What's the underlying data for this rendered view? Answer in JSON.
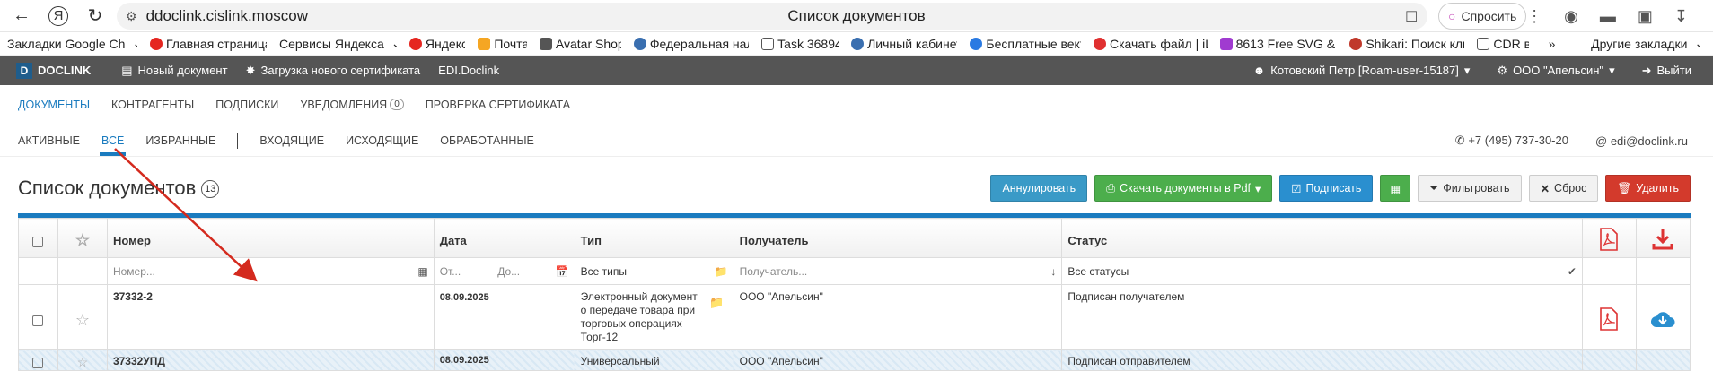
{
  "browser": {
    "url": "ddoclink.cislink.moscow",
    "tab_title": "Список документов",
    "ask_label": "Спросить"
  },
  "bookmarks": [
    {
      "label": "Закладки Google Ch",
      "color": "#ffffff"
    },
    {
      "label": "Главная страница",
      "color": "#e52620"
    },
    {
      "label": "Сервисы Яндекса",
      "color": "#ffffff"
    },
    {
      "label": "Яндекс",
      "color": "#e52620"
    },
    {
      "label": "Почта",
      "color": "#f5a623"
    },
    {
      "label": "Avatar Shop",
      "color": "#555555"
    },
    {
      "label": "Федеральная нал",
      "color": "#3a6fb0"
    },
    {
      "label": "Task 36894",
      "color": "#ffffff"
    },
    {
      "label": "Личный кабинет",
      "color": "#3a6fb0"
    },
    {
      "label": "Бесплатные вект",
      "color": "#2a7ae2"
    },
    {
      "label": "Скачать файл | iL",
      "color": "#e03030"
    },
    {
      "label": "8613 Free SVG & I",
      "color": "#a03bd0"
    },
    {
      "label": "Shikari: Поиск кли",
      "color": "#c0392b"
    },
    {
      "label": "CDR в",
      "color": "#555555"
    }
  ],
  "bookmarks_other": "Другие закладки",
  "app": {
    "logo": "DOCLINK",
    "new_doc": "Новый документ",
    "upload_cert": "Загрузка нового сертификата",
    "edi": "EDI.Doclink",
    "user": "Котовский Петр [Roam-user-15187]",
    "org": "ООО \"Апельсин\"",
    "logout": "Выйти"
  },
  "main_nav": {
    "documents": "ДОКУМЕНТЫ",
    "contractors": "КОНТРАГЕНТЫ",
    "subscriptions": "ПОДПИСКИ",
    "notifications": "УВЕДОМЛЕНИЯ",
    "notifications_count": "0",
    "check_cert": "ПРОВЕРКА СЕРТИФИКАТА"
  },
  "sub_nav": {
    "active": "АКТИВНЫЕ",
    "all": "ВСЕ",
    "favorites": "ИЗБРАННЫЕ",
    "incoming": "ВХОДЯЩИЕ",
    "outgoing": "ИСХОДЯЩИЕ",
    "processed": "ОБРАБОТАННЫЕ",
    "phone": "+7 (495) 737-30-20",
    "email": "edi@doclink.ru"
  },
  "list": {
    "title": "Список документов",
    "count": "13"
  },
  "buttons": {
    "annul": "Аннулировать",
    "download_pdf": "Скачать документы в Pdf",
    "sign": "Подписать",
    "filter": "Фильтровать",
    "reset": "Сброс",
    "delete": "Удалить"
  },
  "table": {
    "headers": {
      "number": "Номер",
      "date": "Дата",
      "type": "Тип",
      "recipient": "Получатель",
      "status": "Статус"
    },
    "filters": {
      "number_placeholder": "Номер...",
      "date_from": "От...",
      "date_to": "До...",
      "type": "Все типы",
      "recipient_placeholder": "Получатель...",
      "status": "Все статусы"
    },
    "rows": [
      {
        "number": "37332-2",
        "date": "08.09.2025",
        "type": "Электронный документ о передаче товара при торговых операциях Торг-12",
        "recipient": "ООО \"Апельсин\"",
        "status": "Подписан получателем"
      },
      {
        "number": "37332УПД",
        "date": "08.09.2025",
        "type": "Универсальный",
        "recipient": "ООО \"Апельсин\"",
        "status": "Подписан отправителем"
      }
    ]
  },
  "colors": {
    "accent": "#1a7bbf",
    "app_bar": "#555555",
    "annotation_arrow": "#d42a1e"
  }
}
